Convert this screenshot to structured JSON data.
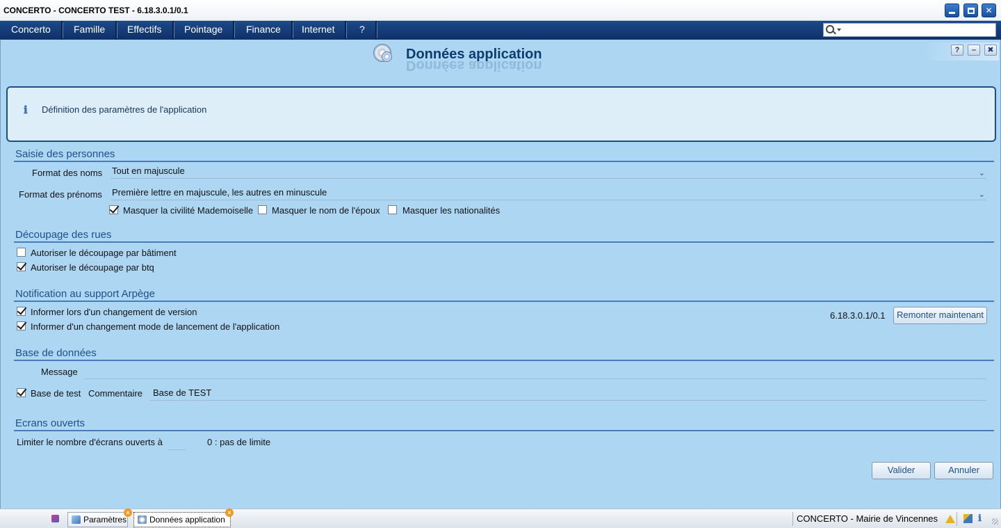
{
  "window": {
    "title": "CONCERTO - CONCERTO TEST - 6.18.3.0.1/0.1"
  },
  "menu": {
    "items": [
      "Concerto",
      "Famille",
      "Effectifs",
      "Pointage",
      "Finance",
      "Internet",
      "?"
    ]
  },
  "search": {
    "placeholder": "",
    "icon": "search-icon"
  },
  "page": {
    "title": "Données application",
    "info": "Définition des paramètres de l'application",
    "help_label": "?"
  },
  "saisie": {
    "title": "Saisie des personnes",
    "format_noms_label": "Format des noms",
    "format_noms_value": "Tout en majuscule",
    "format_prenoms_label": "Format des prénoms",
    "format_prenoms_value": "Première lettre en majuscule, les autres en minuscule",
    "cb_civilite": {
      "label": "Masquer la civilité Mademoiselle",
      "checked": true
    },
    "cb_epoux": {
      "label": "Masquer le nom de l'époux",
      "checked": false
    },
    "cb_nationalites": {
      "label": "Masquer les nationalités",
      "checked": false
    }
  },
  "decoupage": {
    "title": "Découpage des rues",
    "cb_batiment": {
      "label": "Autoriser le découpage par bâtiment",
      "checked": false
    },
    "cb_btq": {
      "label": "Autoriser le découpage par btq",
      "checked": true
    }
  },
  "notification": {
    "title": "Notification au support Arpège",
    "cb_version": {
      "label": "Informer lors d'un changement de version",
      "checked": true
    },
    "cb_lancement": {
      "label": "Informer d'un changement mode de lancement de l'application",
      "checked": true
    },
    "version": "6.18.3.0.1/0.1",
    "remonter_label": "Remonter maintenant"
  },
  "base": {
    "title": "Base de données",
    "message_label": "Message",
    "message_value": "",
    "cb_test": {
      "label": "Base de test",
      "checked": true
    },
    "commentaire_label": "Commentaire",
    "commentaire_value": "Base de TEST"
  },
  "ecrans": {
    "title": "Ecrans ouverts",
    "limiter_label": "Limiter le nombre d'écrans ouverts à",
    "limiter_value": "",
    "hint": "0 : pas de limite"
  },
  "actions": {
    "valider": "Valider",
    "annuler": "Annuler"
  },
  "taskbar": {
    "tasks": [
      {
        "label": "Paramètres"
      },
      {
        "label": "Données application"
      }
    ],
    "status": "CONCERTO - Mairie de Vincennes"
  }
}
